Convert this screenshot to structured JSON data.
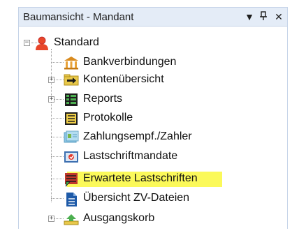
{
  "panel": {
    "title": "Baumansicht - Mandant",
    "controls": {
      "dropdown": "▼",
      "pin": "ᵖ",
      "close": "✕"
    }
  },
  "tree": {
    "root": {
      "label": "Standard",
      "expander": "−",
      "icon": "user-icon"
    },
    "items": [
      {
        "label": "Bankverbindungen",
        "icon": "bank-icon",
        "expander": ""
      },
      {
        "label": "Kontenübersicht",
        "icon": "folder-arrow-icon",
        "expander": "+"
      },
      {
        "label": "Reports",
        "icon": "report-icon",
        "expander": "+"
      },
      {
        "label": "Protokolle",
        "icon": "protocol-icon",
        "expander": ""
      },
      {
        "label": "Zahlungsempf./Zahler",
        "icon": "contacts-icon",
        "expander": ""
      },
      {
        "label": "Lastschriftmandate",
        "icon": "mandate-icon",
        "expander": ""
      },
      {
        "label": "Erwartete Lastschriften",
        "icon": "expected-debits-icon",
        "expander": "",
        "highlighted": true
      },
      {
        "label": "Übersicht ZV-Dateien",
        "icon": "document-icon",
        "expander": ""
      },
      {
        "label": "Ausgangskorb",
        "icon": "outbox-icon",
        "expander": "+"
      }
    ]
  },
  "colors": {
    "highlight": "#fbf95a",
    "titlebar": "#e4ecf7"
  }
}
